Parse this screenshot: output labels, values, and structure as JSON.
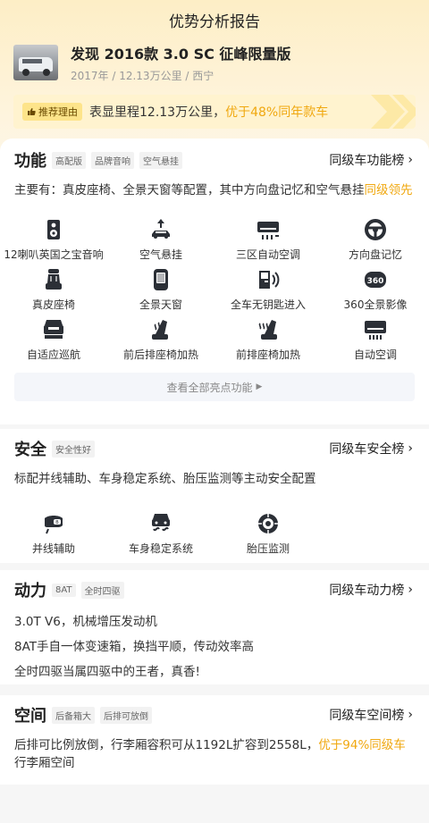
{
  "header": {
    "title": "优势分析报告"
  },
  "car": {
    "name": "发现 2016款 3.0 SC 征峰限量版",
    "meta": "2017年 / 12.13万公里 / 西宁"
  },
  "reason": {
    "tag": "推荐理由",
    "text": "表显里程12.13万公里，",
    "highlight": "优于48%同年款车"
  },
  "function": {
    "title": "功能",
    "chips": [
      "高配版",
      "品牌音响",
      "空气悬挂"
    ],
    "rank": "同级车功能榜",
    "summary": "主要有：真皮座椅、全景天窗等配置，其中方向盘记忆和空气悬挂",
    "summary_hl": "同级领先",
    "features": [
      {
        "label": "12喇叭英国之宝音响",
        "icon": "speaker-icon"
      },
      {
        "label": "空气悬挂",
        "icon": "air-suspension-icon"
      },
      {
        "label": "三区自动空调",
        "icon": "tri-zone-ac-icon"
      },
      {
        "label": "方向盘记忆",
        "icon": "steering-memory-icon"
      },
      {
        "label": "真皮座椅",
        "icon": "leather-seat-icon"
      },
      {
        "label": "全景天窗",
        "icon": "panoramic-sunroof-icon"
      },
      {
        "label": "全车无钥匙进入",
        "icon": "keyless-entry-icon"
      },
      {
        "label": "360全景影像",
        "icon": "camera-360-icon"
      },
      {
        "label": "自适应巡航",
        "icon": "adaptive-cruise-icon"
      },
      {
        "label": "前后排座椅加热",
        "icon": "seat-heating-icon"
      },
      {
        "label": "前排座椅加热",
        "icon": "front-seat-heating-icon"
      },
      {
        "label": "自动空调",
        "icon": "auto-ac-icon"
      }
    ],
    "more": "查看全部亮点功能"
  },
  "safety": {
    "title": "安全",
    "chips": [
      "安全性好"
    ],
    "rank": "同级车安全榜",
    "summary": "标配并线辅助、车身稳定系统、胎压监测等主动安全配置",
    "features": [
      {
        "label": "并线辅助",
        "icon": "lane-assist-icon"
      },
      {
        "label": "车身稳定系统",
        "icon": "stability-icon"
      },
      {
        "label": "胎压监测",
        "icon": "tire-pressure-icon"
      }
    ]
  },
  "power": {
    "title": "动力",
    "chips": [
      "8AT",
      "全时四驱"
    ],
    "rank": "同级车动力榜",
    "lines": [
      "3.0T V6，机械增压发动机",
      "8AT手自一体变速箱，换挡平顺，传动效率高",
      "全时四驱当属四驱中的王者，真香!"
    ]
  },
  "space": {
    "title": "空间",
    "chips": [
      "后备箱大",
      "后排可放倒"
    ],
    "rank": "同级车空间榜",
    "summary": "后排可比例放倒，行李厢容积可从1192L扩容到2558L，",
    "summary_hl": "优于94%同级车",
    "summary_tail": "行李厢空间"
  },
  "colors": {
    "accent": "#f0a810",
    "icon": "#2b2f36"
  }
}
